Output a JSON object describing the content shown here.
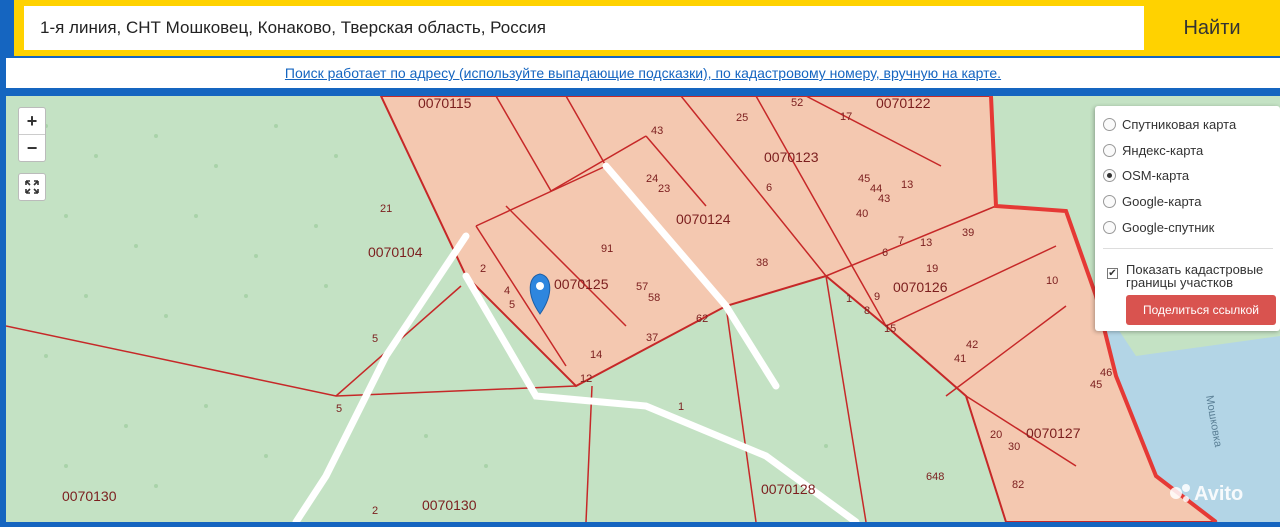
{
  "search": {
    "value": "1-я линия, СНТ Мошковец, Конаково, Тверская область, Россия",
    "button_label": "Найти",
    "help_text": "Поиск работает по адресу (используйте выпадающие подсказки), по кадастровому номеру, вручную на карте."
  },
  "map": {
    "zoom_in": "+",
    "zoom_out": "−",
    "fullscreen_icon": "expand-arrows-icon",
    "colors": {
      "forest": "#c4e2c4",
      "parcel_fill": "#f4c8b0",
      "parcel_border": "#c62828",
      "water": "#b3d5e6",
      "road": "#ffffff",
      "marker": "#2e86de"
    },
    "block_labels": [
      "0070115",
      "0070122",
      "0070123",
      "0070124",
      "0070125",
      "0070126",
      "0070127",
      "0070104",
      "0070130",
      "0070130",
      "0070128"
    ],
    "parcel_numbers": [
      "43",
      "52",
      "25",
      "17",
      "6",
      "45",
      "44",
      "43",
      "13",
      "40",
      "24",
      "23",
      "91",
      "38",
      "39",
      "7",
      "13",
      "6",
      "19",
      "10",
      "2",
      "4",
      "5",
      "57",
      "58",
      "37",
      "62",
      "14",
      "12",
      "1",
      "9",
      "8",
      "15",
      "41",
      "42",
      "45",
      "46",
      "20",
      "30",
      "82",
      "648",
      "21",
      "5",
      "5",
      "1",
      "2"
    ],
    "street_label": "Мошковка"
  },
  "layers": {
    "options": [
      "Спутниковая карта",
      "Яндекс-карта",
      "OSM-карта",
      "Google-карта",
      "Google-спутник"
    ],
    "selected_index": 2,
    "cadastral_label": "Показать кадастровые границы участков",
    "cadastral_checked": true,
    "share_label": "Поделиться ссылкой"
  },
  "watermark": "Avito"
}
